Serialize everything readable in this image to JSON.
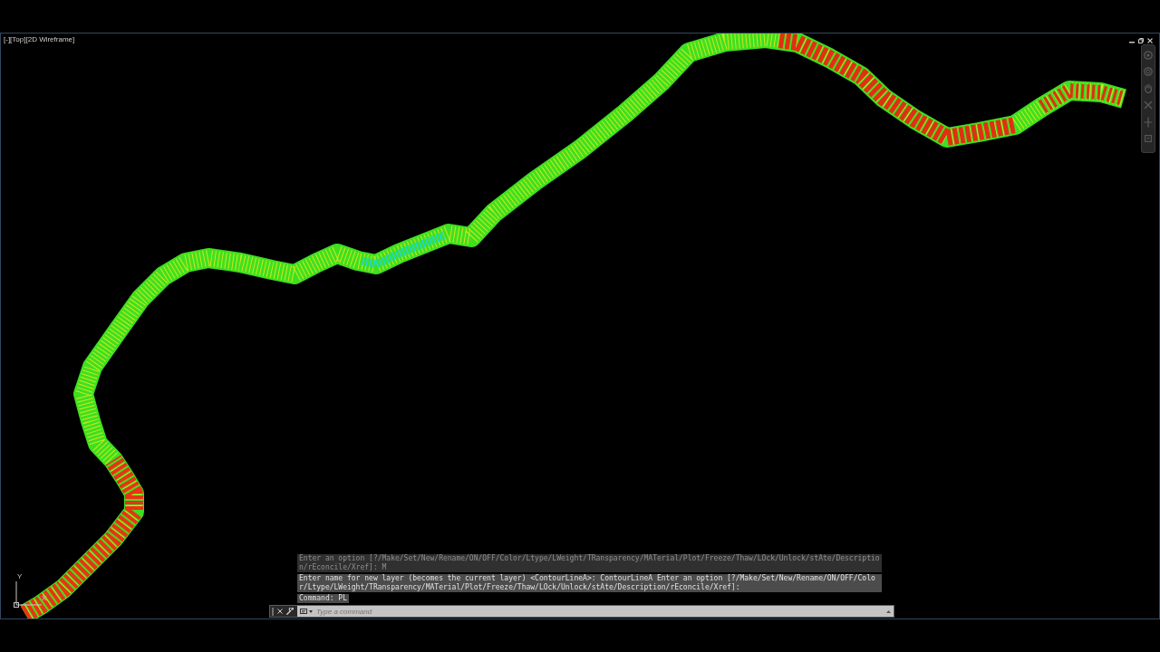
{
  "viewport": {
    "label": "[-][Top][2D Wireframe]"
  },
  "ucs_icon": {
    "y_label": "Y",
    "x_label": "X"
  },
  "command_line": {
    "history": [
      {
        "faded": true,
        "text": "Enter an option [?/Make/Set/New/Rename/ON/OFF/Color/Ltype/LWeight/TRansparency/MATerial/Plot/Freeze/Thaw/LOck/Unlock/stAte/Description/rEconcile/Xref]: M"
      },
      {
        "faded": false,
        "text": "Enter name for new layer (becomes the current layer) <ContourLineA>: ContourLineA Enter an option [?/Make/Set/New/Rename/ON/OFF/Color/Ltype/LWeight/TRansparency/MATerial/Plot/Freeze/Thaw/LOck/Unlock/stAte/Description/rEconcile/Xref]:"
      },
      {
        "faded": false,
        "text": "Command: PL"
      }
    ],
    "input": {
      "placeholder": "Type a command"
    }
  }
}
